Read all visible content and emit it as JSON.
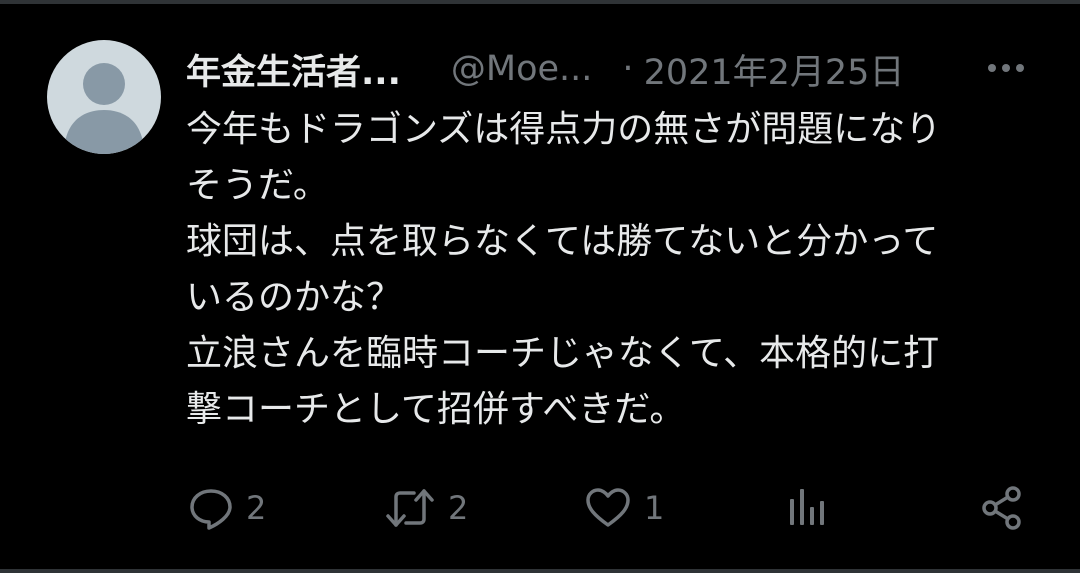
{
  "tweet": {
    "author": {
      "display_name": "年金生活者...",
      "handle": "@Moe...",
      "avatar_icon": "default-avatar-icon"
    },
    "separator": "·",
    "date": "2021年2月25日",
    "more_icon": "more-horizontal-icon",
    "text_lines": [
      "今年もドラゴンズは得点力の無さが問題になり",
      "そうだ。",
      "球団は、点を取らなくては勝てないと分かって",
      "いるのかな？",
      "立浪さんを臨時コーチじゃなくて、本格的に打",
      "撃コーチとして招併すべきだ。"
    ],
    "actions": {
      "reply": {
        "icon": "reply-icon",
        "count": "2"
      },
      "retweet": {
        "icon": "retweet-icon",
        "count": "2"
      },
      "like": {
        "icon": "heart-icon",
        "count": "1"
      },
      "analytics": {
        "icon": "analytics-icon"
      },
      "share": {
        "icon": "share-icon"
      }
    }
  },
  "colors": {
    "background": "#000000",
    "primary_text": "#e7e9ea",
    "secondary_text": "#71767b",
    "avatar_bg": "#cfd9de",
    "avatar_figure": "#8899a6"
  }
}
